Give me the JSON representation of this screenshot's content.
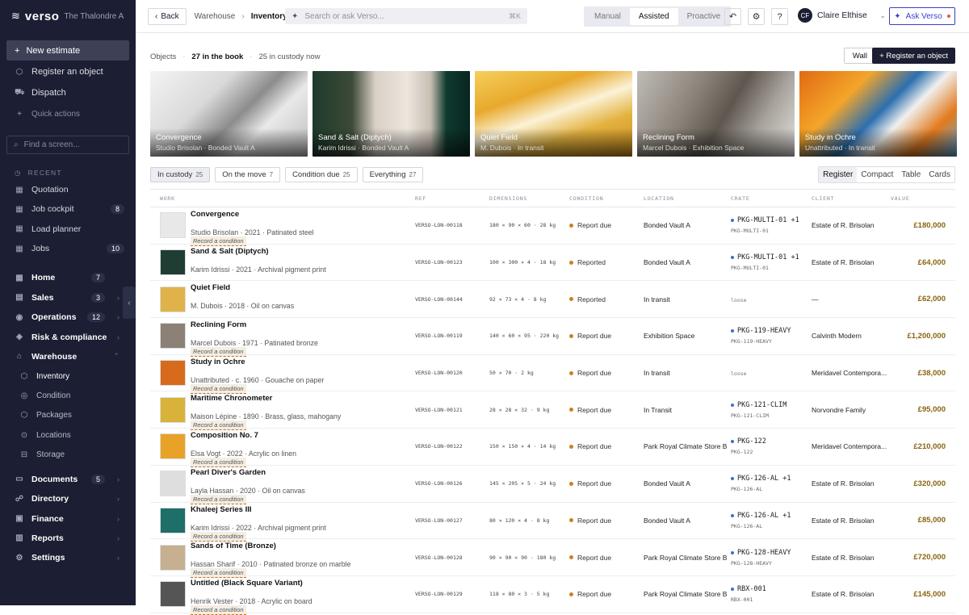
{
  "app": {
    "logo": "verso",
    "org": "The Thalondre Ar..."
  },
  "sidebar": {
    "new_estimate": "New estimate",
    "actions": [
      {
        "label": "Register an object",
        "icon": "cube-icon"
      },
      {
        "label": "Dispatch",
        "icon": "truck-icon"
      }
    ],
    "quick_actions": "Quick actions",
    "find_placeholder": "Find a screen...",
    "recent_label": "RECENT",
    "recent": [
      {
        "label": "Quotation",
        "count": ""
      },
      {
        "label": "Job cockpit",
        "count": "8"
      },
      {
        "label": "Load planner",
        "count": ""
      },
      {
        "label": "Jobs",
        "count": "10"
      }
    ],
    "groups_top": [
      {
        "label": "Home",
        "count": "7"
      },
      {
        "label": "Sales",
        "count": "3"
      },
      {
        "label": "Operations",
        "count": "12"
      },
      {
        "label": "Risk & compliance",
        "count": ""
      }
    ],
    "warehouse": {
      "label": "Warehouse",
      "items": [
        "Inventory",
        "Condition",
        "Packages",
        "Locations",
        "Storage"
      ]
    },
    "groups_bottom": [
      {
        "label": "Documents",
        "count": "5"
      },
      {
        "label": "Directory",
        "count": ""
      },
      {
        "label": "Finance",
        "count": ""
      },
      {
        "label": "Reports",
        "count": ""
      },
      {
        "label": "Settings",
        "count": ""
      }
    ]
  },
  "topbar": {
    "back": "Back",
    "crumb_parent": "Warehouse",
    "crumb_current": "Inventory",
    "search_placeholder": "Search or ask Verso...",
    "search_shortcut": "⌘K",
    "modes": [
      "Manual",
      "Assisted",
      "Proactive"
    ],
    "active_mode": "Assisted",
    "user_initials": "CF",
    "user_name": "Claire Elthise",
    "ask": "Ask Verso"
  },
  "summary": {
    "objects": "Objects",
    "in_book": "27 in the book",
    "in_custody": "25 in custody now",
    "wall": "Wall",
    "register": "+ Register an object"
  },
  "featured": [
    {
      "title": "Convergence",
      "sub": "Studio Brisolan · Bonded Vault A"
    },
    {
      "title": "Sand & Salt (Diptych)",
      "sub": "Karim Idrissi · Bonded Vault A"
    },
    {
      "title": "Quiet Field",
      "sub": "M. Dubois · In transit"
    },
    {
      "title": "Reclining Form",
      "sub": "Marcel Dubois · Exhibition Space"
    },
    {
      "title": "Study in Ochre",
      "sub": "Unattributed · In transit"
    }
  ],
  "filters": [
    {
      "label": "In custody",
      "count": "25"
    },
    {
      "label": "On the move",
      "count": "7"
    },
    {
      "label": "Condition due",
      "count": "25"
    },
    {
      "label": "Everything",
      "count": "27"
    }
  ],
  "views": [
    "Register",
    "Compact",
    "Table",
    "Cards"
  ],
  "table": {
    "headers": [
      "WORK",
      "REF",
      "DIMENSIONS",
      "CONDITION",
      "LOCATION",
      "CRATE",
      "CLIENT",
      "VALUE"
    ],
    "record_label": "Record a condition",
    "rows": [
      {
        "title": "Convergence",
        "sub": "Studio Brisolan · 2021 · Patinated steel",
        "record": true,
        "ref": "VERSO-LON-00118",
        "dims": "180 × 90 × 60 · 28 kg",
        "cond": "Report due",
        "loc": "Bonded Vault A",
        "crate": "PKG-MULTI-01 +1",
        "crate2": "PKG-MULTI-01",
        "client": "Estate of R. Brisolan",
        "value": "£180,000"
      },
      {
        "title": "Sand & Salt (Diptych)",
        "sub": "Karim Idrissi · 2021 · Archival pigment print",
        "record": false,
        "ref": "VERSO-LON-00123",
        "dims": "100 × 300 × 4 · 18 kg",
        "cond": "Reported",
        "loc": "Bonded Vault A",
        "crate": "PKG-MULTI-01 +1",
        "crate2": "PKG-MULTI-01",
        "client": "Estate of R. Brisolan",
        "value": "£64,000"
      },
      {
        "title": "Quiet Field",
        "sub": "M. Dubois · 2018 · Oil on canvas",
        "record": false,
        "ref": "VERSO-LON-00144",
        "dims": "92 × 73 × 4 · 8 kg",
        "cond": "Reported",
        "loc": "In transit",
        "crate": "",
        "crate2": "",
        "loose": "loose",
        "client": "—",
        "value": "£62,000"
      },
      {
        "title": "Reclining Form",
        "sub": "Marcel Dubois · 1971 · Patinated bronze",
        "record": true,
        "ref": "VERSO-LON-00119",
        "dims": "140 × 60 × 95 · 220 kg",
        "cond": "Report due",
        "loc": "Exhibition Space",
        "crate": "PKG-119-HEAVY",
        "crate2": "PKG-119-HEAVY",
        "client": "Calvinth Modern",
        "value": "£1,200,000"
      },
      {
        "title": "Study in Ochre",
        "sub": "Unattributed · c. 1960 · Gouache on paper",
        "record": true,
        "ref": "VERSO-LON-00120",
        "dims": "50 × 70 · 2 kg",
        "cond": "Report due",
        "loc": "In transit",
        "crate": "",
        "crate2": "",
        "loose": "loose",
        "client": "Meridavel Contempora...",
        "value": "£38,000"
      },
      {
        "title": "Maritime Chronometer",
        "sub": "Maison Lépine · 1890 · Brass, glass, mahogany",
        "record": true,
        "ref": "VERSO-LON-00121",
        "dims": "28 × 28 × 32 · 9 kg",
        "cond": "Report due",
        "loc": "In Transit",
        "crate": "PKG-121-CLIM",
        "crate2": "PKG-121-CLIM",
        "client": "Norvondre Family",
        "value": "£95,000"
      },
      {
        "title": "Composition No. 7",
        "sub": "Elsa Vogt · 2022 · Acrylic on linen",
        "record": true,
        "ref": "VERSO-LON-00122",
        "dims": "150 × 150 × 4 · 14 kg",
        "cond": "Report due",
        "loc": "Park Royal Climate Store B",
        "crate": "PKG-122",
        "crate2": "PKG-122",
        "client": "Meridavel Contempora...",
        "value": "£210,000"
      },
      {
        "title": "Pearl Diver's Garden",
        "sub": "Layla Hassan · 2020 · Oil on canvas",
        "record": true,
        "ref": "VERSO-LON-00126",
        "dims": "145 × 205 × 5 · 24 kg",
        "cond": "Report due",
        "loc": "Bonded Vault A",
        "crate": "PKG-126-AL +1",
        "crate2": "PKG-126-AL",
        "client": "Estate of R. Brisolan",
        "value": "£320,000"
      },
      {
        "title": "Khaleej Series III",
        "sub": "Karim Idrissi · 2022 · Archival pigment print",
        "record": true,
        "ref": "VERSO-LON-00127",
        "dims": "80 × 120 × 4 · 8 kg",
        "cond": "Report due",
        "loc": "Bonded Vault A",
        "crate": "PKG-126-AL +1",
        "crate2": "PKG-126-AL",
        "client": "Estate of R. Brisolan",
        "value": "£85,000"
      },
      {
        "title": "Sands of Time (Bronze)",
        "sub": "Hassan Sharif · 2010 · Patinated bronze on marble",
        "record": true,
        "ref": "VERSO-LON-00128",
        "dims": "90 × 90 × 90 · 180 kg",
        "cond": "Report due",
        "loc": "Park Royal Climate Store B",
        "crate": "PKG-128-HEAVY",
        "crate2": "PKG-128-HEAVY",
        "client": "Estate of R. Brisolan",
        "value": "£720,000"
      },
      {
        "title": "Untitled (Black Square Variant)",
        "sub": "Henrik Vester · 2018 · Acrylic on board",
        "record": true,
        "ref": "VERSO-LON-00129",
        "dims": "118 × 80 × 3 · 5 kg",
        "cond": "Report due",
        "loc": "Park Royal Climate Store B",
        "crate": "RBX-001",
        "crate2": "RBX-001",
        "client": "Estate of R. Brisolan",
        "value": "£145,000"
      }
    ]
  },
  "colors": {
    "report_due": "#c9821e",
    "reported": "#c9821e",
    "value": "#8a6410",
    "accent": "#3b3fd0",
    "sidebar": "#1c1f33"
  }
}
